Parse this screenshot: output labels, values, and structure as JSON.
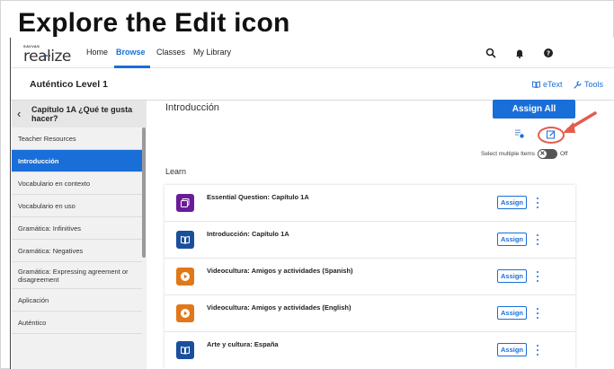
{
  "heading": "Explore the Edit icon",
  "logo": {
    "small": "SAVVAS",
    "word": "realize"
  },
  "nav": {
    "home": "Home",
    "browse": "Browse",
    "classes": "Classes",
    "library": "My Library"
  },
  "course": {
    "title": "Auténtico Level 1",
    "etext": "eText",
    "tools": "Tools"
  },
  "sidebar": {
    "back_icon": "chevron-left-icon",
    "title": "Capítulo 1A ¿Qué te gusta hacer?",
    "items": [
      {
        "label": "Teacher Resources"
      },
      {
        "label": "Introducción"
      },
      {
        "label": "Vocabulario en contexto"
      },
      {
        "label": "Vocabulario en uso"
      },
      {
        "label": "Gramática: Infinitives"
      },
      {
        "label": "Gramática: Negatives"
      },
      {
        "label": "Gramática: Expressing agreement or disagreement"
      },
      {
        "label": "Aplicación"
      },
      {
        "label": "Auténtico"
      }
    ],
    "active_index": 1
  },
  "main": {
    "section_title": "Introducción",
    "assign_all": "Assign All",
    "select_multiple": "Select multiple Items",
    "toggle_state": "Off",
    "toggle_symbol": "✕",
    "learn_label": "Learn",
    "rows": [
      {
        "title": "Essential Question: Capítulo 1A",
        "assign": "Assign",
        "icon": "cards-icon",
        "color": "#6a1b9a"
      },
      {
        "title": "Introducción: Capítulo 1A",
        "assign": "Assign",
        "icon": "book-icon",
        "color": "#1b4f9c"
      },
      {
        "title": "Videocultura: Amigos y actividades (Spanish)",
        "assign": "Assign",
        "icon": "play-icon",
        "color": "#e0781a"
      },
      {
        "title": "Videocultura: Amigos y actividades (English)",
        "assign": "Assign",
        "icon": "play-icon",
        "color": "#e0781a"
      },
      {
        "title": "Arte y cultura: España",
        "assign": "Assign",
        "icon": "book-icon",
        "color": "#1b4f9c"
      }
    ]
  },
  "colors": {
    "accent": "#1a6ed8",
    "highlight": "#e35d4b"
  }
}
